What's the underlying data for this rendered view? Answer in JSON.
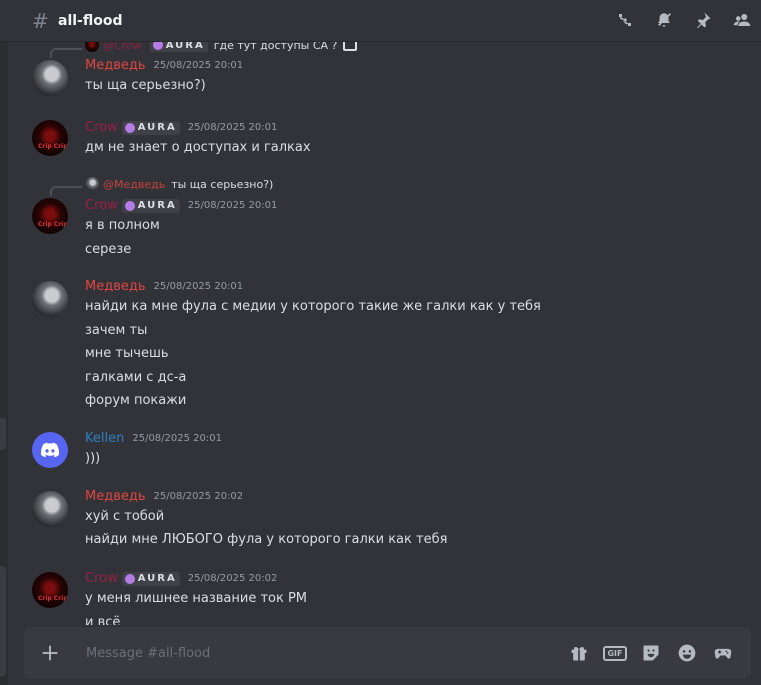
{
  "header": {
    "hash": "#",
    "channel": "all-flood"
  },
  "users": {
    "bear": "Медведь",
    "crow": "Crow",
    "kellen": "Kellen",
    "crow_tag": "AURA"
  },
  "messages": [
    {
      "reply": {
        "name": "@Crow",
        "text": "где тут доступы CA ?"
      },
      "author": "Медведь",
      "time": "25/08/2025 20:01",
      "lines": [
        "ты ща серьезно?)"
      ]
    },
    {
      "author": "Crow",
      "tag": "AURA",
      "time": "25/08/2025 20:01",
      "lines": [
        "дм не знает о доступах и галках"
      ]
    },
    {
      "reply": {
        "name": "@Медведь",
        "text": "ты ща серьезно?)"
      },
      "author": "Crow",
      "tag": "AURA",
      "time": "25/08/2025 20:01",
      "lines": [
        "я в полном",
        "серезе"
      ]
    },
    {
      "author": "Медведь",
      "time": "25/08/2025 20:01",
      "lines": [
        "найди ка мне фула с медии у которого такие же галки как у тебя",
        "зачем ты",
        "мне тычешь",
        "галками с дс-а",
        "форум покажи"
      ]
    },
    {
      "author": "Kellen",
      "time": "25/08/2025 20:01",
      "lines": [
        ")))"
      ]
    },
    {
      "author": "Медведь",
      "time": "25/08/2025 20:02",
      "lines": [
        "хуй с тобой",
        "найди мне ЛЮБОГО фула у которого галки как тебя"
      ]
    },
    {
      "author": "Crow",
      "tag": "AURA",
      "time": "25/08/2025 20:02",
      "lines": [
        "у меня лишнее название ток РМ",
        "и всё"
      ]
    }
  ],
  "composer": {
    "placeholder": "Message #all-flood",
    "gif_label": "GIF"
  }
}
